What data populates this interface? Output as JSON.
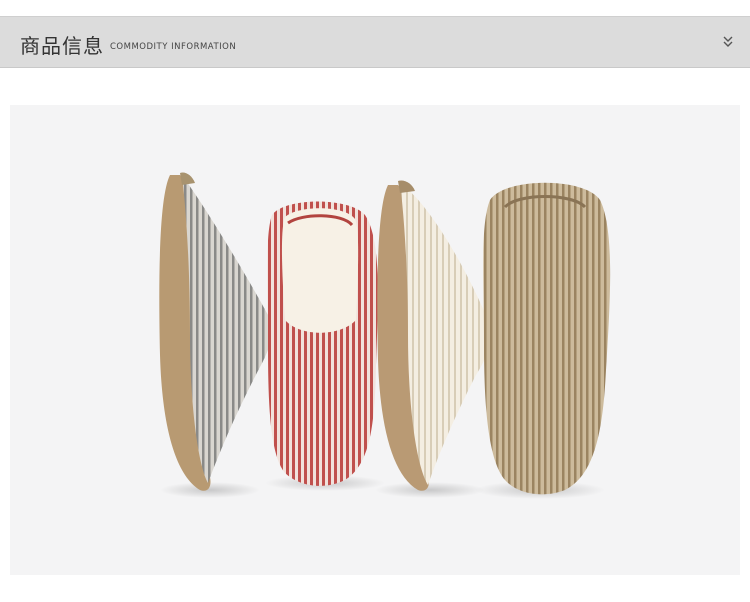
{
  "header": {
    "title_cn": "商品信息",
    "title_en": "COMMODITY INFORMATION",
    "toggle_icon": "chevron-double-down-icon"
  },
  "colors": {
    "header_bg": "#dcdcdc",
    "photo_bg": "#f4f4f5",
    "slipper_gray": "#8e8e8e",
    "slipper_red": "#c0504d",
    "slipper_cream": "#e9dfcc",
    "slipper_tan": "#a99270",
    "sole": "#b99a74"
  },
  "product_image": {
    "subject": "four striped house slippers",
    "variants": [
      "gray",
      "red",
      "beige",
      "khaki"
    ]
  }
}
